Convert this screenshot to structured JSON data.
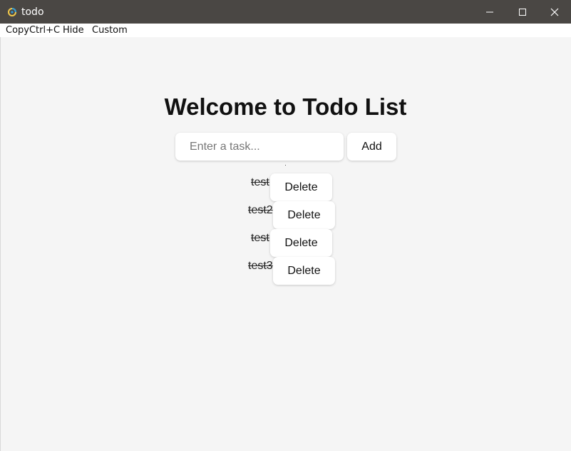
{
  "window": {
    "title": "todo",
    "colors": {
      "titlebar": "#4a4744",
      "background": "#f5f5f5"
    }
  },
  "menubar": {
    "items": [
      "CopyCtrl+C",
      "Hide",
      "Custom"
    ]
  },
  "main": {
    "heading": "Welcome to Todo List",
    "input": {
      "placeholder": "Enter a task...",
      "value": ""
    },
    "add_label": "Add",
    "todos": [
      {
        "text": "test",
        "completed": true,
        "delete_label": "Delete"
      },
      {
        "text": "test2",
        "completed": true,
        "delete_label": "Delete"
      },
      {
        "text": "test",
        "completed": true,
        "delete_label": "Delete"
      },
      {
        "text": "test3",
        "completed": true,
        "delete_label": "Delete"
      }
    ]
  }
}
